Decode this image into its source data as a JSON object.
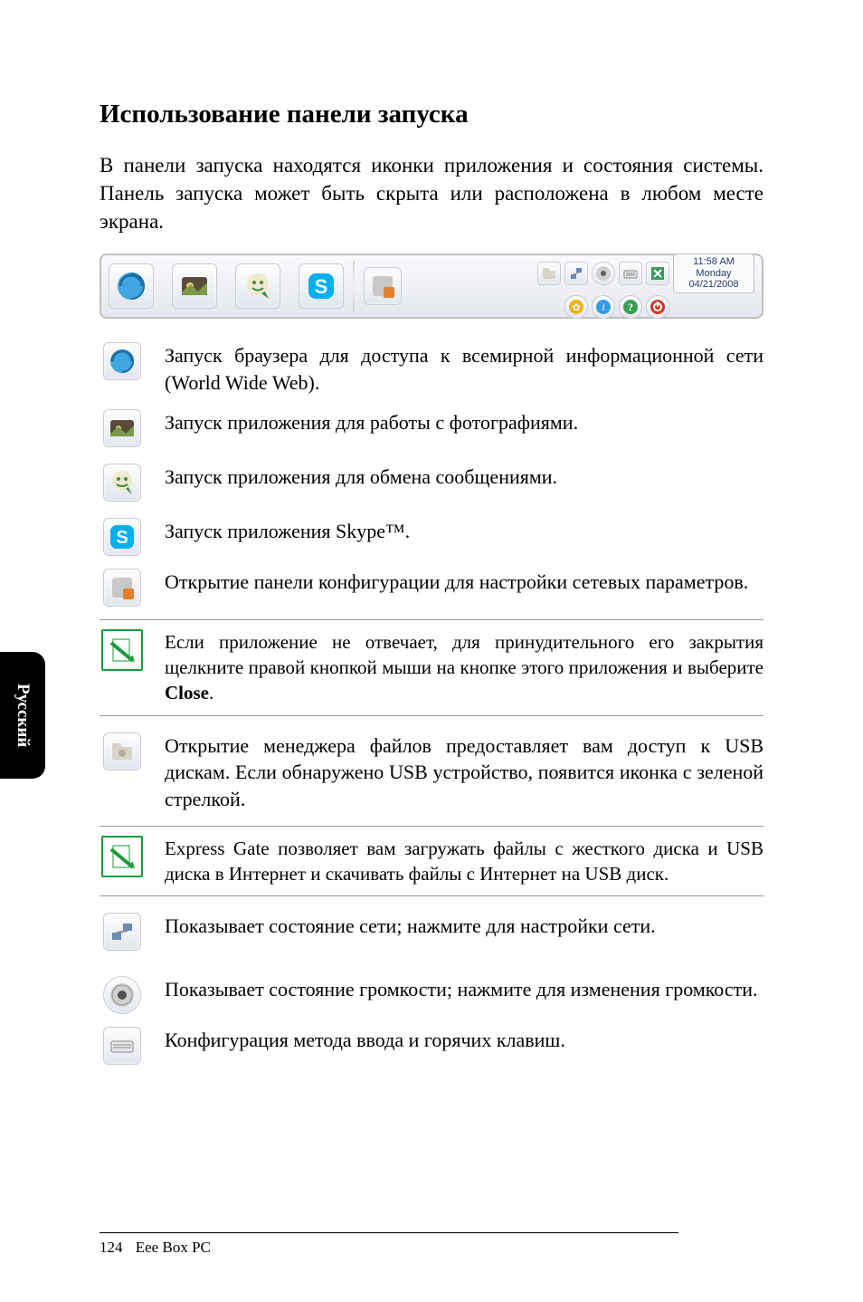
{
  "side_tab": "Русский",
  "title": "Использование панели запуска",
  "intro": "В панели запуска находятся иконки приложения и состояния системы. Панель запуска может быть скрыта или расположена в любом месте экрана.",
  "clock": {
    "time": "11:58 AM",
    "day": "Monday",
    "date": "04/21/2008"
  },
  "rows": {
    "browser": "Запуск браузера для доступа к всемирной информационной сети (World Wide Web).",
    "photo": "Запуск приложения для работы с фотографиями.",
    "im": "Запуск приложения для обмена сообщениями.",
    "skype": "Запуск приложения Skype™.",
    "config": "Открытие панели конфигурации для настройки сетевых параметров.",
    "filemgr": "Открытие менеджера файлов предоставляет вам доступ к USB дискам. Если обнаружено USB устройство, появится иконка с зеленой стрелкой.",
    "network": "Показывает состояние сети; нажмите для настройки сети.",
    "volume": "Показывает состояние громкости; нажмите для изменения громкости.",
    "keyboard": "Конфигурация метода ввода и горячих клавиш."
  },
  "notes": {
    "close_pre": "Если приложение не отвечает, для принудительного его закрытия щелкните правой кнопкой мыши на кнопке этого приложения и выберите ",
    "close_bold": "Close",
    "close_post": ".",
    "express": "Express Gate позволяет вам загружать файлы с жесткого диска и USB диска в Интернет и скачивать файлы с Интернет на USB диск."
  },
  "footer": {
    "page": "124",
    "product": "Eee Box PC"
  }
}
